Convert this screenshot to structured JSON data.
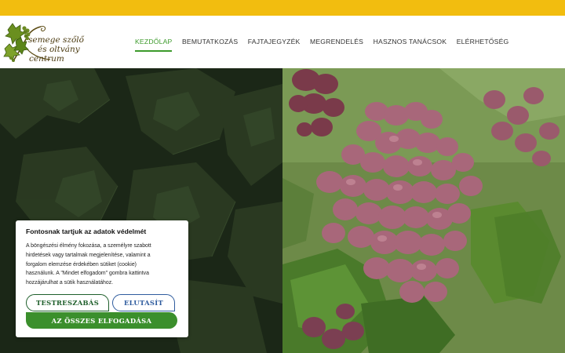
{
  "logo": {
    "line1": "semege szőlő",
    "line2": "és oltvány",
    "line3": "centrum"
  },
  "nav": {
    "items": [
      {
        "label": "KEZDŐLAP",
        "active": true
      },
      {
        "label": "BEMUTATKOZÁS",
        "active": false
      },
      {
        "label": "FAJTAJEGYZÉK",
        "active": false
      },
      {
        "label": "MEGRENDELÉS",
        "active": false
      },
      {
        "label": "HASZNOS TANÁCSOK",
        "active": false
      },
      {
        "label": "ELÉRHETŐSÉG",
        "active": false
      }
    ]
  },
  "cookie": {
    "title": "Fontosnak tartjuk az adatok védelmét",
    "body_lines": [
      "A böngészési élmény fokozása, a személyre szabott",
      "hirdetések vagy tartalmak megjelenítése, valamint a",
      "forgalom elemzése érdekében sütiket (cookie)",
      "használunk. A \"Mindet elfogadom\" gombra kattintva",
      "hozzájárulhat a sütik használatához."
    ],
    "customize_label": "TESTRESZABÁS",
    "reject_label": "ELUTASÍT",
    "accept_label": "AZ ÖSSZES ELFOGADÁSA"
  },
  "colors": {
    "topbar": "#f2bd0f",
    "brand_green": "#3c9a2b",
    "accept_button": "#3b8f2c",
    "reject_border": "#2f5c9e"
  },
  "images": {
    "hero_left": "dark grapevine leaves background",
    "hero_right": "bunches of pink table grapes on the vine"
  }
}
